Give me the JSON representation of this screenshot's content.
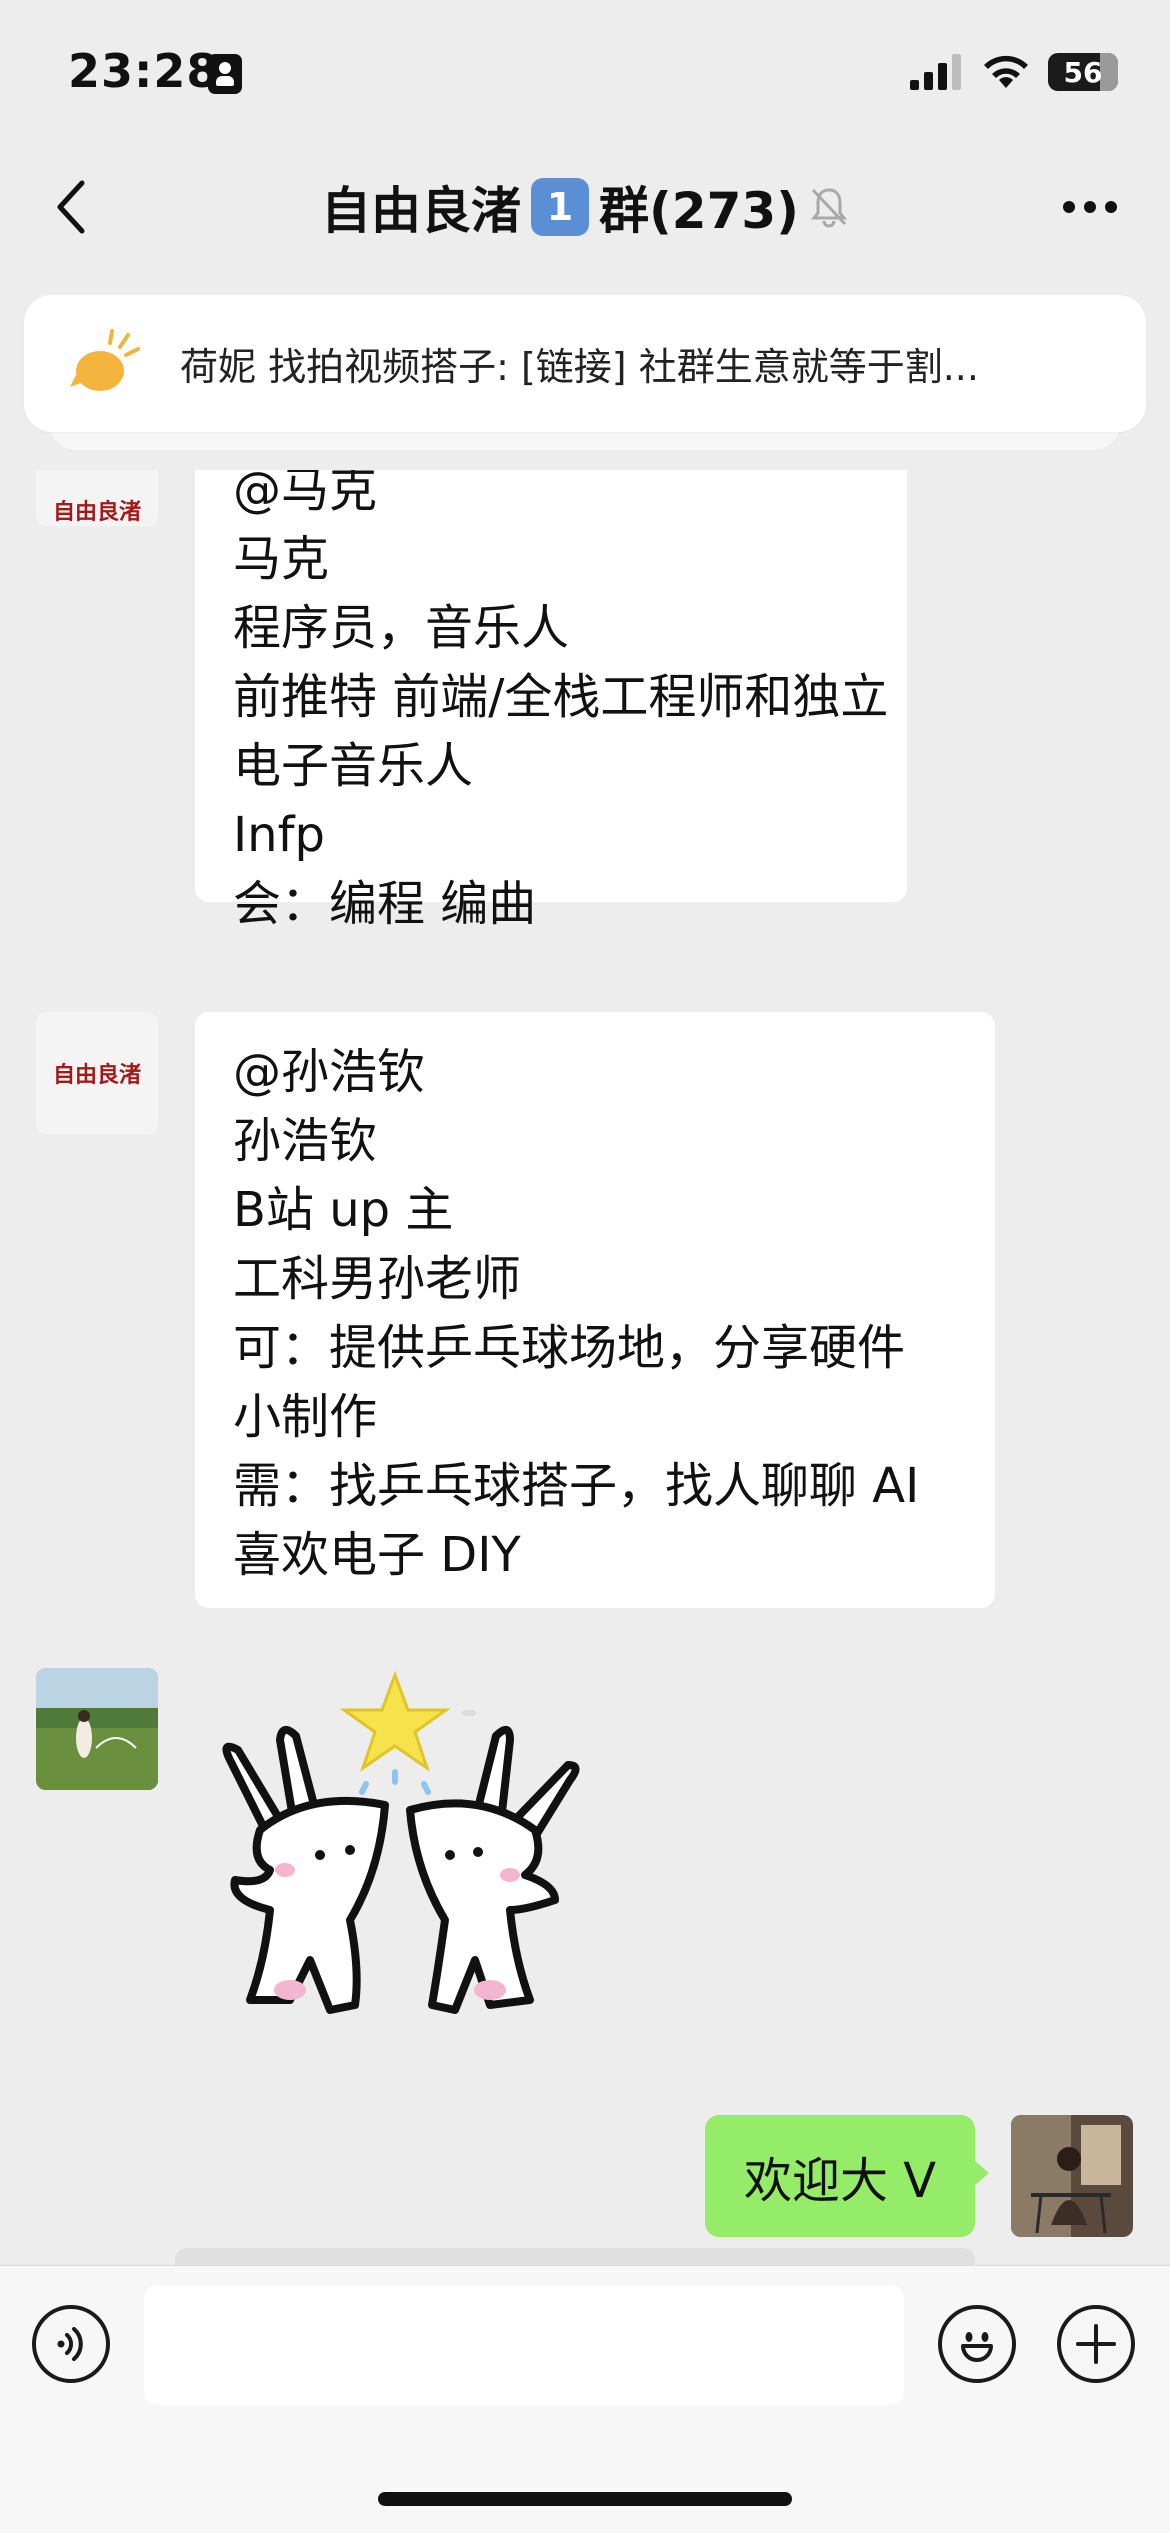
{
  "status_bar": {
    "time": "23:28",
    "battery": "56",
    "icons": [
      "id-card-icon",
      "signal-icon",
      "wifi-icon",
      "battery-icon"
    ]
  },
  "nav": {
    "title": "自由良渚",
    "title_badge": "1",
    "title_suffix": "群(273)",
    "muted_icon": "muted-bell-icon",
    "back_icon": "back-chevron-icon",
    "more_icon": "more-dots-icon"
  },
  "pinned": {
    "icon": "announcement-horn-icon",
    "text": "荷妮 找拍视频搭子: [链接] 社群生意就等于割..."
  },
  "messages": [
    {
      "sender_avatar": "自由良渚",
      "lines": [
        "@马克",
        "马克",
        "程序员，音乐人",
        "前推特 前端/全栈工程师和独立",
        "电子音乐人",
        "Infp",
        "会：编程 编曲"
      ]
    },
    {
      "sender_avatar": "自由良渚",
      "lines": [
        "@孙浩钦",
        "孙浩钦",
        "B站 up 主",
        "工科男孙老师",
        "可：提供乒乓球场地，分享硬件",
        "小制作",
        "需：找乒乓球搭子，找人聊聊 AI",
        "喜欢电子 DIY"
      ]
    },
    {
      "sender_avatar": "photo",
      "sticker": "high-five-bunnies-sticker"
    },
    {
      "self": true,
      "text": "欢迎大 V"
    }
  ],
  "input_bar": {
    "voice_icon": "voice-icon",
    "emoji_icon": "emoji-icon",
    "plus_icon": "plus-icon"
  },
  "colors": {
    "background": "#ededed",
    "self_bubble": "#95ec69",
    "bubble": "#ffffff",
    "logo_red": "#a31818"
  }
}
